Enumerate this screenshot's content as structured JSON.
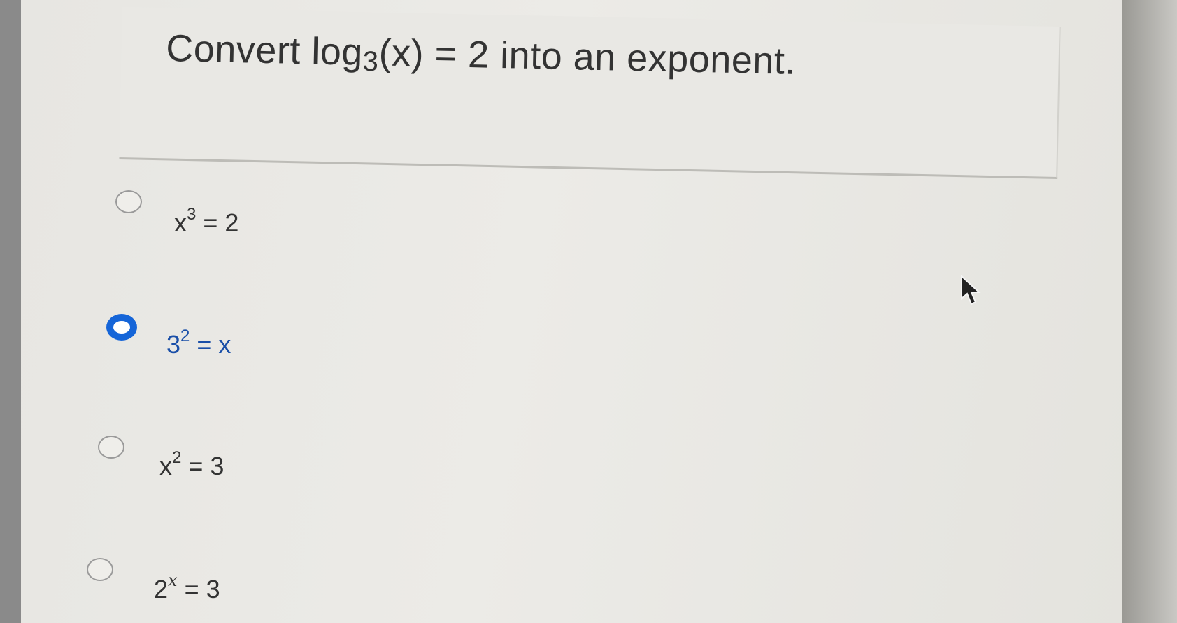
{
  "question": {
    "prefix": "Convert log",
    "base": "3",
    "suffix": "(x) = 2 into an exponent."
  },
  "options": [
    {
      "base": "x",
      "exp": "3",
      "rest": " = 2",
      "selected": false
    },
    {
      "base": "3",
      "exp": "2",
      "rest": " = x",
      "selected": true
    },
    {
      "base": "x",
      "exp": "2",
      "rest": " = 3",
      "selected": false
    },
    {
      "base": "2",
      "exp": "x",
      "rest": " = 3",
      "selected": false
    }
  ],
  "colors": {
    "selected_accent": "#1565d8",
    "text": "#333333"
  },
  "icons": {
    "pointer": "mouse-pointer-icon"
  }
}
